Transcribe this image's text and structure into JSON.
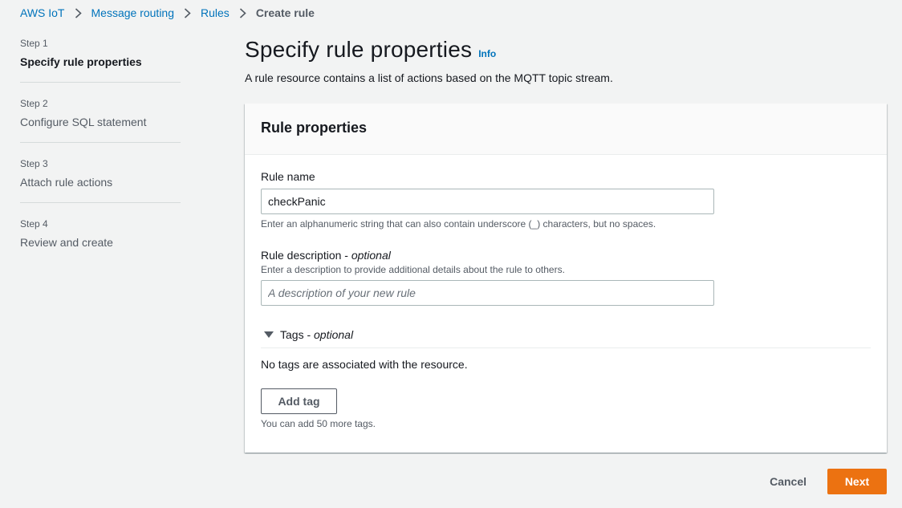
{
  "breadcrumb": {
    "items": [
      "AWS IoT",
      "Message routing",
      "Rules"
    ],
    "current": "Create rule"
  },
  "steps": [
    {
      "num": "Step 1",
      "label": "Specify rule properties",
      "active": true
    },
    {
      "num": "Step 2",
      "label": "Configure SQL statement",
      "active": false
    },
    {
      "num": "Step 3",
      "label": "Attach rule actions",
      "active": false
    },
    {
      "num": "Step 4",
      "label": "Review and create",
      "active": false
    }
  ],
  "page": {
    "title": "Specify rule properties",
    "info": "Info",
    "description": "A rule resource contains a list of actions based on the MQTT topic stream."
  },
  "panel": {
    "title": "Rule properties",
    "rule_name": {
      "label": "Rule name",
      "value": "checkPanic",
      "constraint": "Enter an alphanumeric string that can also contain underscore (_) characters, but no spaces."
    },
    "rule_description": {
      "label": "Rule description - ",
      "label_optional": "optional",
      "description": "Enter a description to provide additional details about the rule to others.",
      "value": "",
      "placeholder": "A description of your new rule"
    },
    "tags": {
      "label": "Tags - ",
      "label_optional": "optional",
      "expanded": true,
      "empty_text": "No tags are associated with the resource.",
      "add_button": "Add tag",
      "hint": "You can add 50 more tags."
    }
  },
  "actions": {
    "cancel": "Cancel",
    "next": "Next"
  },
  "colors": {
    "link": "#0073bb",
    "primary": "#ec7211",
    "background": "#f2f3f3"
  },
  "icons": {
    "breadcrumb_separator": "chevron-right-icon",
    "tags_toggle": "caret-down-icon"
  }
}
